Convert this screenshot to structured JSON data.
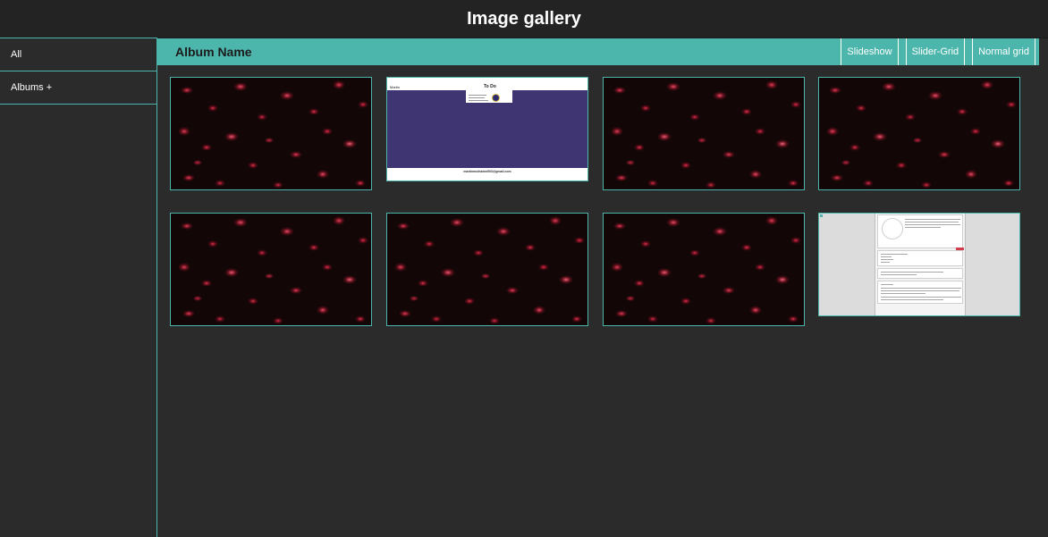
{
  "header": {
    "title": "Image gallery"
  },
  "sidebar": {
    "items": [
      {
        "label": "All"
      },
      {
        "label": "Albums +"
      }
    ]
  },
  "album": {
    "title": "Album Name",
    "view_buttons": [
      {
        "label": "Slideshow"
      },
      {
        "label": "Slider-Grid"
      },
      {
        "label": "Normal grid"
      }
    ]
  },
  "todo_thumb": {
    "brand": "Martin",
    "heading": "To Do",
    "email": "martinmuthatnn503@gmail.com"
  },
  "colors": {
    "accent": "#4db6ac",
    "background": "#2b2b2b",
    "header_bg": "#232323",
    "todo_purple": "#3f3573"
  }
}
